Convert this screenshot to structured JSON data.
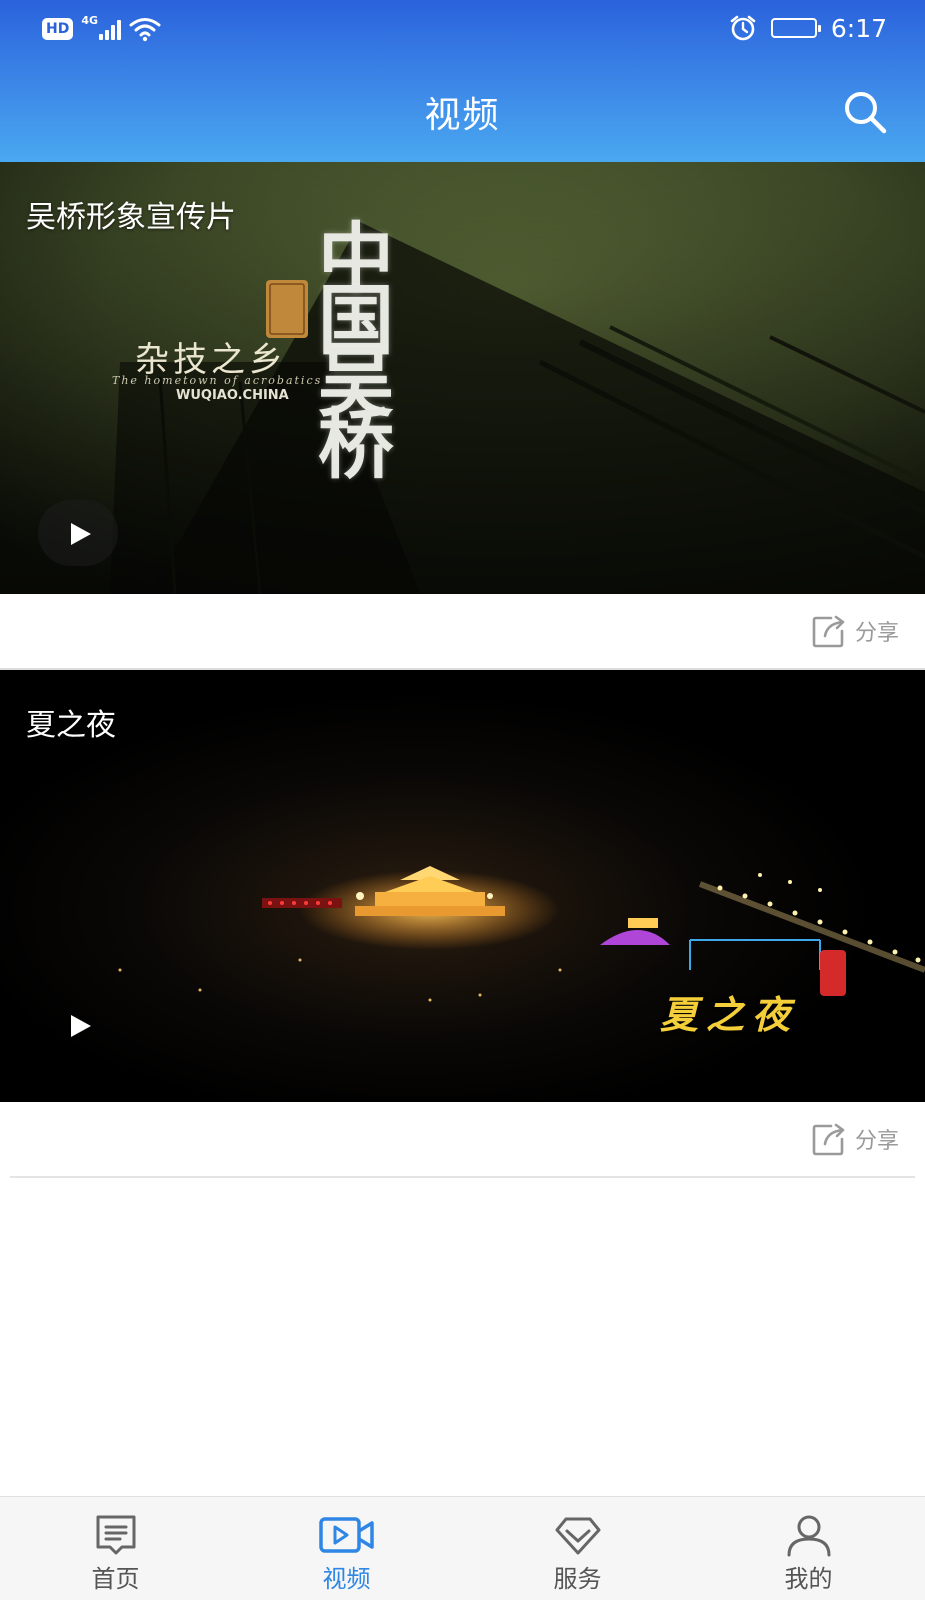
{
  "status_bar": {
    "hd_label": "HD",
    "network_label": "4G",
    "time": "6:17",
    "icons": [
      "wifi-icon",
      "alarm-icon",
      "battery-icon"
    ]
  },
  "header": {
    "title": "视频",
    "search_icon": "search-icon"
  },
  "videos": [
    {
      "title": "吴桥形象宣传片",
      "overlay_calligraphy": "中国吴桥",
      "overlay_subtitle": "杂技之乡",
      "overlay_english": "The hometown of acrobatics",
      "overlay_domain": "WUQIAO.CHINA",
      "share_label": "分享"
    },
    {
      "title": "夏之夜",
      "overlay_calligraphy": "夏之夜",
      "share_label": "分享"
    }
  ],
  "tabbar": {
    "items": [
      {
        "label": "首页",
        "icon": "news-icon",
        "active": false
      },
      {
        "label": "视频",
        "icon": "video-camera-icon",
        "active": true
      },
      {
        "label": "服务",
        "icon": "diamond-icon",
        "active": false
      },
      {
        "label": "我的",
        "icon": "user-icon",
        "active": false
      }
    ]
  },
  "colors": {
    "header_top": "#2a62dc",
    "header_bottom": "#4aa8f0",
    "tab_active": "#2f86e4",
    "tab_inactive": "#555555",
    "share_gray": "#9a9a9a"
  }
}
